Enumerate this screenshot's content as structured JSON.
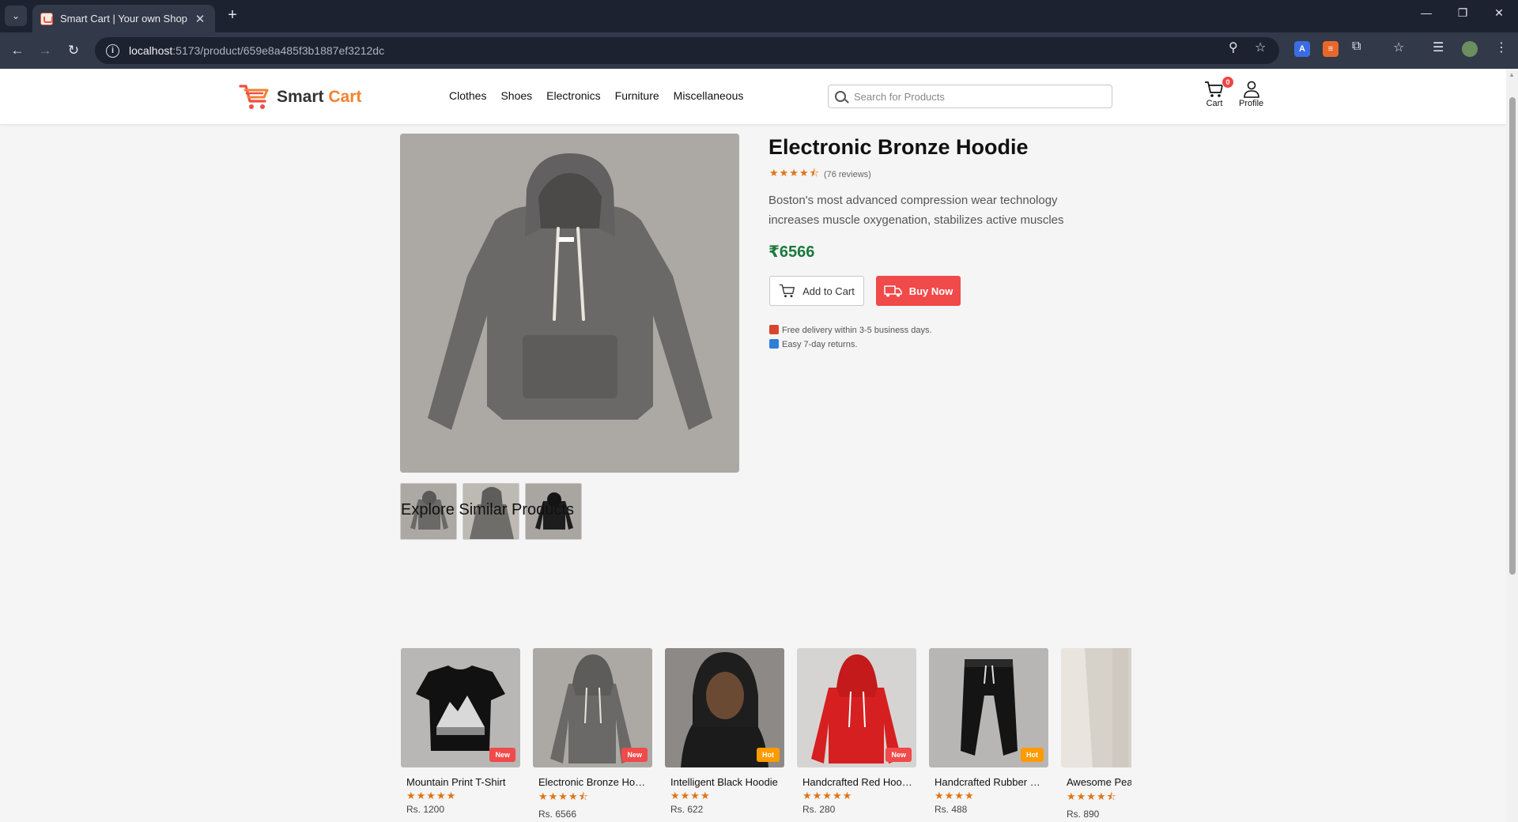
{
  "browser": {
    "tab_title": "Smart Cart | Your own Shop",
    "url_host": "localhost",
    "url_path": ":5173/product/659e8a485f3b1887ef3212dc"
  },
  "site": {
    "logo_word1": "Smart",
    "logo_word2": "Cart",
    "brand_color": "#f4812e",
    "nav": [
      "Clothes",
      "Shoes",
      "Electronics",
      "Furniture",
      "Miscellaneous"
    ],
    "search_placeholder": "Search for Products",
    "cart_label": "Cart",
    "cart_count": "0",
    "profile_label": "Profile"
  },
  "product": {
    "title": "Electronic Bronze Hoodie",
    "rating": 4.5,
    "stars": "★★★★⯪",
    "reviews": "(76 reviews)",
    "description": "Boston's most advanced compression wear technology increases muscle oxygenation, stabilizes active muscles",
    "price": "₹6566",
    "price_color": "#1a7a3e",
    "add_to_cart_label": "Add to Cart",
    "buy_now_label": "Buy Now",
    "buy_color": "#f04a4a",
    "delivery_note": "Free delivery within 3-5 business days.",
    "returns_note": "Easy 7-day returns."
  },
  "similar": {
    "title": "Explore Similar Products",
    "items": [
      {
        "name": "Mountain Print T-Shirt",
        "stars": "★★★★★",
        "price": "Rs. 1200",
        "badge": "New",
        "badge_color": "#f04a4a"
      },
      {
        "name": "Electronic Bronze Hoodie",
        "stars": "★★★★⯪",
        "price": "Rs. 6566",
        "badge": "New",
        "badge_color": "#f04a4a"
      },
      {
        "name": "Intelligent Black Hoodie",
        "stars": "★★★★",
        "price": "Rs. 622",
        "badge": "Hot",
        "badge_color": "#ff9a00"
      },
      {
        "name": "Handcrafted Red Hoodie",
        "stars": "★★★★★",
        "price": "Rs. 280",
        "badge": "New",
        "badge_color": "#f04a4a"
      },
      {
        "name": "Handcrafted Rubber Joggers",
        "stars": "★★★★",
        "price": "Rs. 488",
        "badge": "Hot",
        "badge_color": "#ff9a00"
      },
      {
        "name": "Awesome Peach Joggers",
        "stars": "★★★★⯪",
        "price": "Rs. 890",
        "badge": "",
        "badge_color": ""
      }
    ]
  }
}
